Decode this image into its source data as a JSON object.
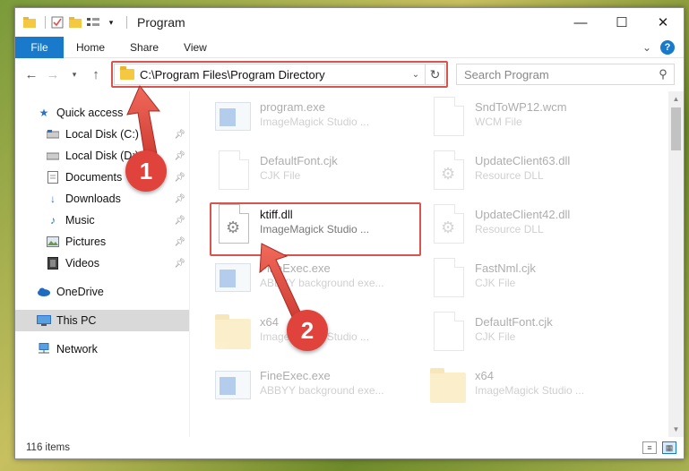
{
  "window": {
    "title": "Program",
    "controls": {
      "minimize": "—",
      "maximize": "☐",
      "close": "✕"
    }
  },
  "ribbon": {
    "tabs": [
      "File",
      "Home",
      "Share",
      "View"
    ]
  },
  "address_bar": {
    "path": "C:\\Program Files\\Program Directory",
    "search_placeholder": "Search Program"
  },
  "sidebar": {
    "items": [
      {
        "label": "Quick access",
        "icon": "star-icon"
      },
      {
        "label": "Local Disk (C:)",
        "icon": "drive-icon",
        "pinned": true
      },
      {
        "label": "Local Disk (D:)",
        "icon": "drive-icon",
        "pinned": true
      },
      {
        "label": "Documents",
        "icon": "documents-icon",
        "pinned": true
      },
      {
        "label": "Downloads",
        "icon": "download-icon",
        "pinned": true
      },
      {
        "label": "Music",
        "icon": "music-icon",
        "pinned": true
      },
      {
        "label": "Pictures",
        "icon": "pictures-icon",
        "pinned": true
      },
      {
        "label": "Videos",
        "icon": "videos-icon",
        "pinned": true
      },
      {
        "label": "OneDrive",
        "icon": "cloud-icon"
      },
      {
        "label": "This PC",
        "icon": "pc-icon",
        "selected": true
      },
      {
        "label": "Network",
        "icon": "network-icon"
      }
    ]
  },
  "files": [
    {
      "name": "program.exe",
      "type": "ImageMagick Studio ...",
      "icon": "app"
    },
    {
      "name": "SndToWP12.wcm",
      "type": "WCM File",
      "icon": "doc"
    },
    {
      "name": "DefaultFont.cjk",
      "type": "CJK File",
      "icon": "doc"
    },
    {
      "name": "UpdateClient63.dll",
      "type": "Resource DLL",
      "icon": "dll"
    },
    {
      "name": "ktiff.dll",
      "type": "ImageMagick Studio ...",
      "icon": "dll"
    },
    {
      "name": "UpdateClient42.dll",
      "type": "Resource DLL",
      "icon": "dll"
    },
    {
      "name": "FineExec.exe",
      "type": "ABBYY background exe...",
      "icon": "app"
    },
    {
      "name": "FastNml.cjk",
      "type": "CJK File",
      "icon": "doc"
    },
    {
      "name": "x64",
      "type": "ImageMagick Studio ...",
      "icon": "folder"
    },
    {
      "name": "DefaultFont.cjk",
      "type": "CJK File",
      "icon": "doc"
    },
    {
      "name": "FineExec.exe",
      "type": "ABBYY background exe...",
      "icon": "app"
    },
    {
      "name": "x64",
      "type": "ImageMagick Studio ...",
      "icon": "folder"
    }
  ],
  "status": {
    "item_count": "116 items"
  },
  "annotations": {
    "step1": "1",
    "step2": "2"
  },
  "colors": {
    "accent": "#1979ca",
    "highlight_red": "#d9534f",
    "badge_red": "#e0433b"
  }
}
